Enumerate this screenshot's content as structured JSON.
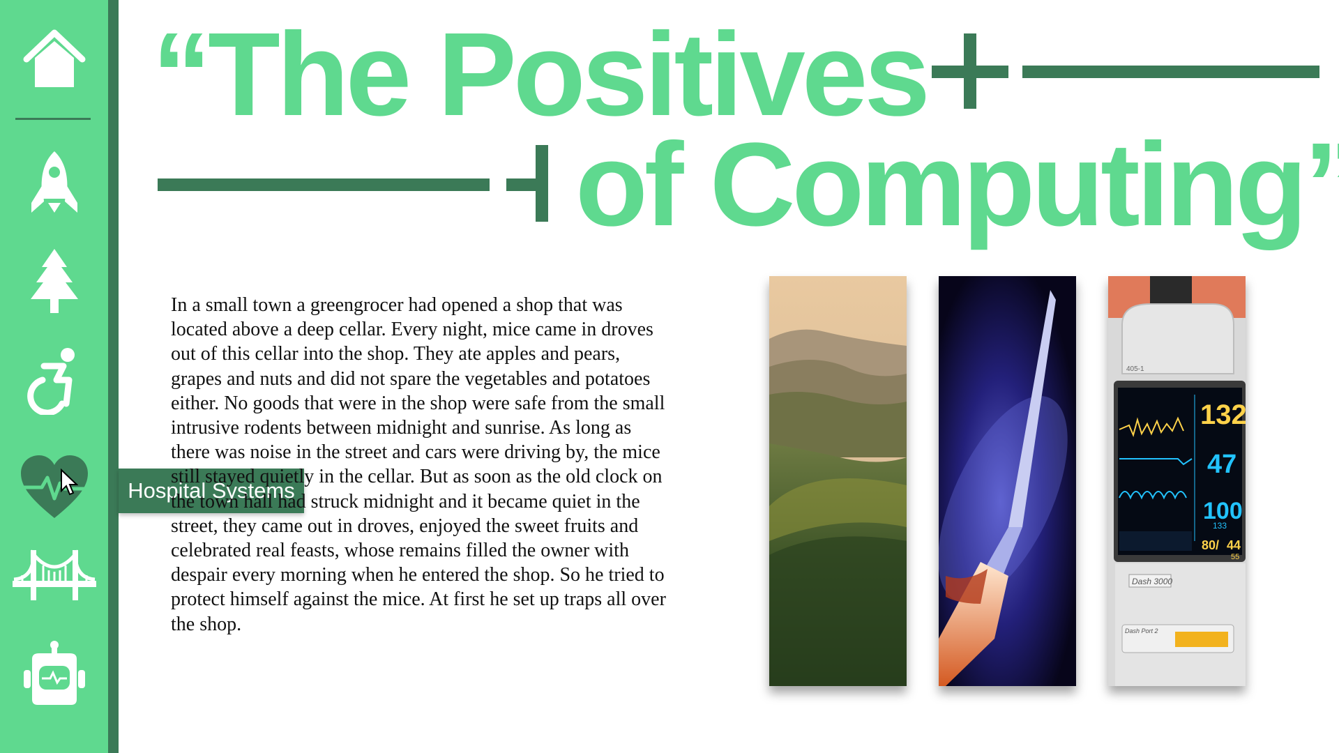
{
  "sidebar": {
    "items": [
      {
        "icon": "home-icon",
        "name": "home"
      },
      {
        "icon": "rocket-icon",
        "name": "rocket"
      },
      {
        "icon": "tree-icon",
        "name": "tree"
      },
      {
        "icon": "accessibility-icon",
        "name": "accessibility"
      },
      {
        "icon": "heart-pulse-icon",
        "name": "hospital-systems"
      },
      {
        "icon": "bridge-icon",
        "name": "bridge"
      },
      {
        "icon": "robot-icon",
        "name": "robot"
      }
    ],
    "tooltip": "Hospital Systems"
  },
  "title": {
    "line1": "“The Positives",
    "line2": "of Computing”"
  },
  "paragraph": "In a small town a greengrocer had opened a shop that was located above a deep cellar. Every night, mice came in droves out of this cellar into the shop. They ate apples and pears, grapes and nuts and did not spare the vegetables and potatoes either. No goods that were in the shop were safe from the small intrusive rodents between midnight and sunrise. As long as there was noise in the street and cars were driving by, the mice still stayed quietly in the cellar. But as soon as the old clock on the town hall had struck midnight and it became quiet in the street, they came out in droves, enjoyed the sweet fruits and celebrated real feasts, whose remains filled the owner with despair every morning when he entered the shop. So he tried to protect himself against the mice. At first he set up traps all over the shop.",
  "images": {
    "monitor": {
      "readings": [
        "132",
        "47",
        "100",
        "133",
        "80/",
        "44",
        "55"
      ],
      "device_label": "Dash 3000",
      "tag_label": "405-1",
      "sticker_label": "Dash Port 2"
    }
  },
  "colors": {
    "accent": "#5fd98f",
    "dark_green": "#3b7a57",
    "text": "#111111",
    "background": "#ffffff"
  }
}
